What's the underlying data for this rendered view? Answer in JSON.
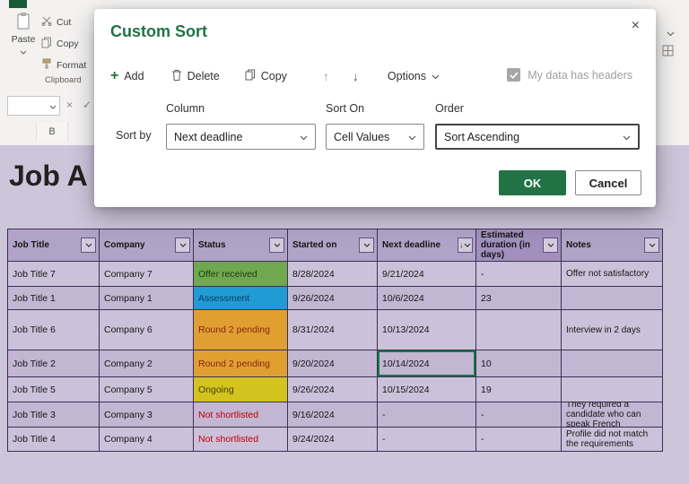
{
  "colors": {
    "excel_green": "#217346",
    "selection_green": "#107c41",
    "not_shortlisted_red": "#c00000"
  },
  "ribbon": {
    "paste": "Paste",
    "cut": "Cut",
    "copy": "Copy",
    "format": "Format",
    "clipboard": "Clipboard",
    "cancel_glyph": "×",
    "enter_glyph": "✓",
    "column_b": "B"
  },
  "dialog": {
    "title": "Custom Sort",
    "close_glyph": "×",
    "add": "Add",
    "delete": "Delete",
    "copy": "Copy",
    "up_arrow": "↑",
    "down_arrow": "↓",
    "options": "Options",
    "headers_label": "My data has headers",
    "col_label": "Column",
    "sorton_label": "Sort On",
    "order_label": "Order",
    "sortby_label": "Sort by",
    "column_value": "Next deadline",
    "sorton_value": "Cell Values",
    "order_value": "Sort Ascending",
    "ok": "OK",
    "cancel": "Cancel"
  },
  "sheet": {
    "title": "Job A",
    "selected_cell": {
      "row": 3,
      "col": 4
    },
    "headers": [
      {
        "label": "Job Title",
        "sorted": false,
        "dark": false
      },
      {
        "label": "Company",
        "sorted": false,
        "dark": false
      },
      {
        "label": "Status",
        "sorted": false,
        "dark": false
      },
      {
        "label": "Started on",
        "sorted": false,
        "dark": false
      },
      {
        "label": "Next deadline",
        "sorted": true,
        "dark": false
      },
      {
        "label": "Estimated duration (in days)",
        "sorted": false,
        "dark": true
      },
      {
        "label": "Notes",
        "sorted": false,
        "dark": false
      }
    ],
    "rows": [
      {
        "cells": [
          "Job Title 7",
          "Company 7",
          "Offer received",
          "8/28/2024",
          "9/21/2024",
          "-",
          "Offer not satisfactory"
        ],
        "status_bg": "#6fa84e",
        "status_fg": "#1d3b0f"
      },
      {
        "cells": [
          "Job Title 1",
          "Company 1",
          "Assessment",
          "9/26/2024",
          "10/6/2024",
          "23",
          ""
        ],
        "status_bg": "#209bd4",
        "status_fg": "#123a5c"
      },
      {
        "cells": [
          "Job Title 6",
          "Company 6",
          "Round 2 pending",
          "8/31/2024",
          "10/13/2024",
          "",
          "Interview in 2 days"
        ],
        "status_bg": "#dfa031",
        "status_fg": "#8b1f10"
      },
      {
        "cells": [
          "Job Title 2",
          "Company 2",
          "Round 2 pending",
          "9/20/2024",
          "10/14/2024",
          "10",
          ""
        ],
        "status_bg": "#dfa031",
        "status_fg": "#8b1f10"
      },
      {
        "cells": [
          "Job Title 5",
          "Company 5",
          "Ongoing",
          "9/26/2024",
          "10/15/2024",
          "19",
          ""
        ],
        "status_bg": "#d2c31f",
        "status_fg": "#45410d"
      },
      {
        "cells": [
          "Job Title 3",
          "Company 3",
          "Not shortlisted",
          "9/16/2024",
          "-",
          "-",
          "They required a candidate who can speak French"
        ],
        "status_bg": null,
        "status_fg": "#c00000"
      },
      {
        "cells": [
          "Job Title 4",
          "Company 4",
          "Not shortlisted",
          "9/24/2024",
          "-",
          "-",
          "Profile did not match the requirements"
        ],
        "status_bg": null,
        "status_fg": "#c00000"
      }
    ]
  }
}
